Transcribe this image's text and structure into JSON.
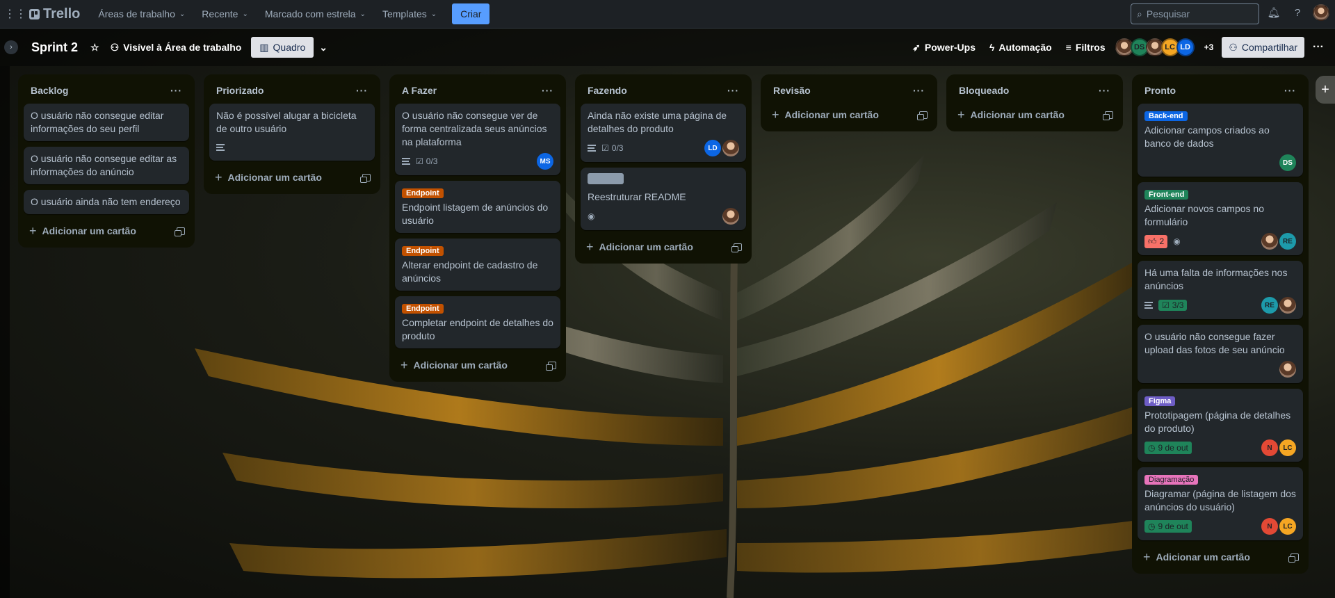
{
  "topnav": {
    "logo": "Trello",
    "items": [
      "Áreas de trabalho",
      "Recente",
      "Marcado com estrela",
      "Templates"
    ],
    "create_label": "Criar",
    "search_placeholder": "Pesquisar"
  },
  "board": {
    "title": "Sprint 2",
    "visibility": "Visível à Área de trabalho",
    "view": "Quadro",
    "powerups": "Power-Ups",
    "automation": "Automação",
    "filters": "Filtros",
    "member_initials": [
      "DS",
      "LC",
      "LD"
    ],
    "more_members": "+3",
    "share": "Compartilhar"
  },
  "add_card_label": "Adicionar um cartão",
  "lists": [
    {
      "title": "Backlog",
      "cards": [
        {
          "title": "O usuário não consegue editar informações do seu perfil"
        },
        {
          "title": "O usuário não consegue editar as informações do anúncio"
        },
        {
          "title": "O usuário ainda não tem endereço"
        }
      ]
    },
    {
      "title": "Priorizado",
      "cards": [
        {
          "title": "Não é possível alugar a bicicleta de outro usuário"
        }
      ]
    },
    {
      "title": "A Fazer",
      "cards": [
        {
          "title": "O usuário não consegue ver de forma centralizada seus anúncios na plataforma",
          "checklist": "0/3",
          "member": "MS"
        },
        {
          "label": "Endpoint",
          "title": "Endpoint listagem de anúncios do usuário"
        },
        {
          "label": "Endpoint",
          "title": "Alterar endpoint de cadastro de anúncios"
        },
        {
          "label": "Endpoint",
          "title": "Completar endpoint de detalhes do produto"
        }
      ]
    },
    {
      "title": "Fazendo",
      "cards": [
        {
          "title": "Ainda não existe uma página de detalhes do produto",
          "checklist": "0/3",
          "member": "LD"
        },
        {
          "title": "Reestruturar README"
        }
      ]
    },
    {
      "title": "Revisão",
      "cards": []
    },
    {
      "title": "Bloqueado",
      "cards": []
    },
    {
      "title": "Pronto",
      "cards": [
        {
          "label": "Back-end",
          "title": "Adicionar campos criados ao banco de dados",
          "member": "DS"
        },
        {
          "label": "Front-end",
          "title": "Adicionar novos campos no formulário",
          "votes": "2",
          "member": "RE"
        },
        {
          "title": "Há uma falta de informações nos anúncios",
          "checklist": "3/3",
          "member": "RE"
        },
        {
          "title": "O usuário não consegue fazer upload das fotos de seu anúncio"
        },
        {
          "label": "Figma",
          "title": "Prototipagem (página de detalhes do produto)",
          "date": "9 de out",
          "members": [
            "N",
            "LC"
          ]
        },
        {
          "label": "Diagramação",
          "title": "Diagramar (página de listagem dos anúncios do usuário)",
          "date": "9 de out",
          "members": [
            "N",
            "LC"
          ]
        }
      ]
    }
  ],
  "colors": {
    "accent": "#579dff",
    "label_endpoint": "#c25100",
    "label_backend": "#0c66e4",
    "label_frontend": "#1f845a",
    "label_figma": "#6e5dc6",
    "label_diagramacao": "#e774bb",
    "member_ds": "#1f845a",
    "member_lc": "#f5a623",
    "member_ld": "#0c66e4",
    "member_ms": "#0c66e4",
    "member_re": "#1d9aaa",
    "member_n": "#e34935"
  }
}
